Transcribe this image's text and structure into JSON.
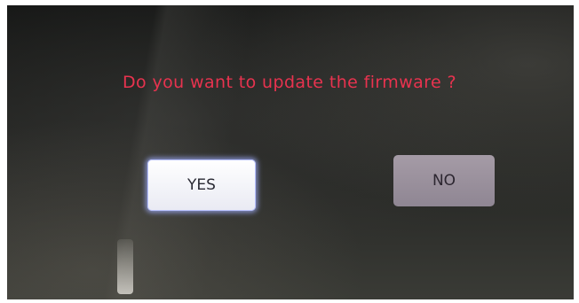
{
  "dialog": {
    "question": "Do you want to update the firmware ?",
    "yes_label": "YES",
    "no_label": "NO"
  },
  "colors": {
    "question_text": "#e8334f",
    "yes_button_bg": "#ffffff",
    "no_button_bg": "#9a909c",
    "screen_bg": "#1d1e1c"
  }
}
